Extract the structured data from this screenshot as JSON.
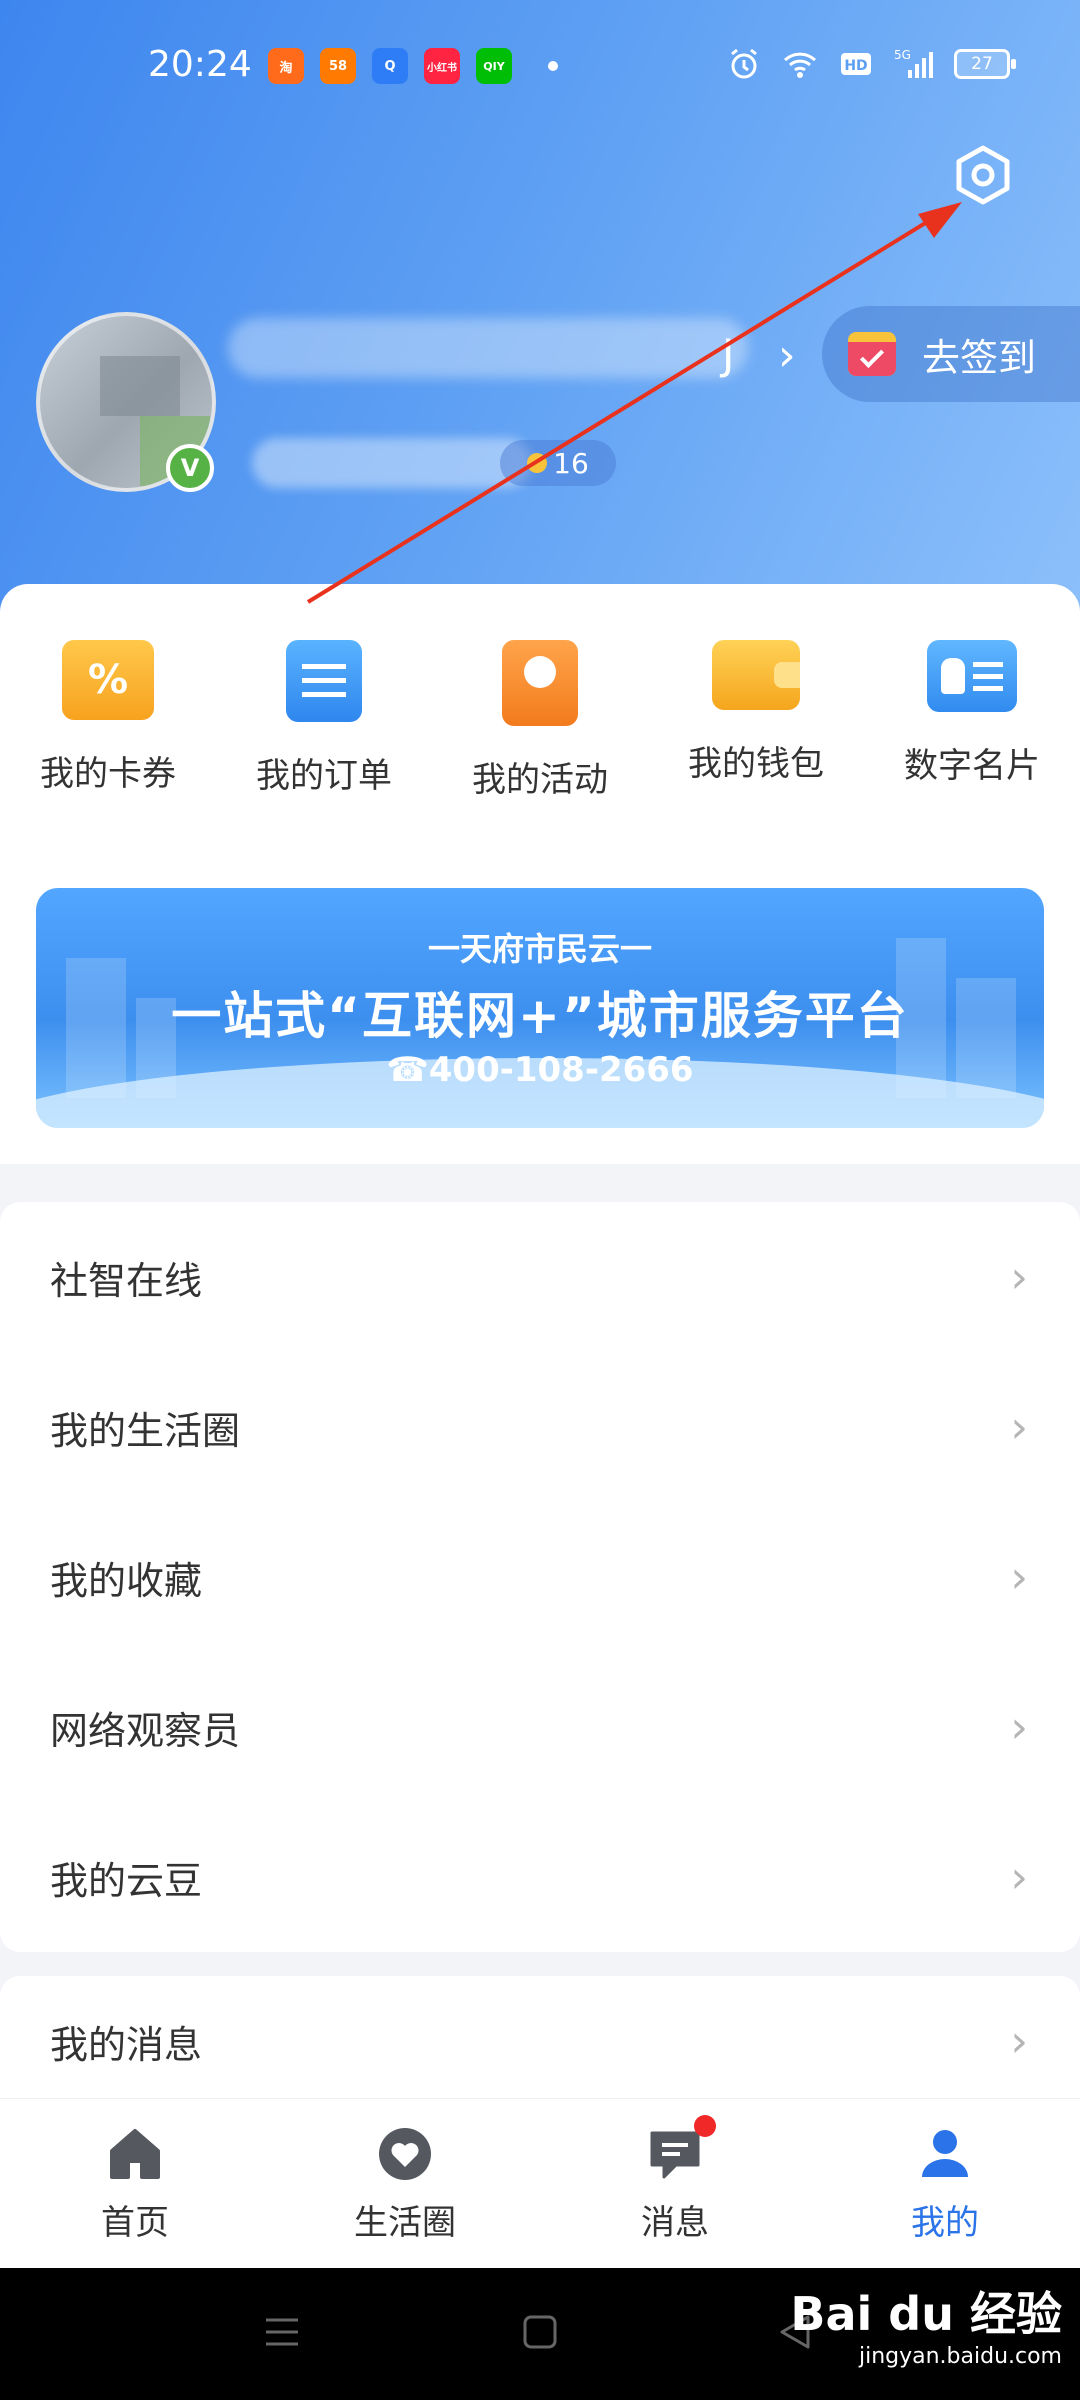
{
  "status_bar": {
    "time": "20:24",
    "apps": [
      {
        "name": "taobao-app-icon",
        "text": "淘",
        "color": "#ff6a1b"
      },
      {
        "name": "58-app-icon",
        "text": "58",
        "color": "#ff7a00"
      },
      {
        "name": "browser-app-icon",
        "text": "Q",
        "color": "#2f7df6"
      },
      {
        "name": "xiaohongshu-app-icon",
        "text": "小红书",
        "color": "#ff2442"
      },
      {
        "name": "iqiyi-app-icon",
        "text": "QIY",
        "color": "#00be06"
      }
    ],
    "battery": "27",
    "network": "5G"
  },
  "profile": {
    "name_visible_tail": "J",
    "level_value": "16"
  },
  "signin_label": "去签到",
  "quick_actions": [
    {
      "label": "我的卡券",
      "icon": "coupon-icon",
      "color": "#f7a21f"
    },
    {
      "label": "我的订单",
      "icon": "order-icon",
      "color": "#2f86ee"
    },
    {
      "label": "我的活动",
      "icon": "activity-icon",
      "color": "#f27b1c"
    },
    {
      "label": "我的钱包",
      "icon": "wallet-icon",
      "color": "#f5a51d"
    },
    {
      "label": "数字名片",
      "icon": "business-card-icon",
      "color": "#318bef"
    }
  ],
  "banner": {
    "line1": "一天府市民云一",
    "line2": "一站式“互联网+”城市服务平台",
    "line3": "☎400-108-2666"
  },
  "menu": [
    {
      "label": "社智在线"
    },
    {
      "label": "我的生活圈"
    },
    {
      "label": "我的收藏"
    },
    {
      "label": "网络观察员"
    },
    {
      "label": "我的云豆"
    }
  ],
  "menu_secondary": [
    {
      "label": "我的消息"
    }
  ],
  "tabs": [
    {
      "label": "首页",
      "icon": "home-icon"
    },
    {
      "label": "生活圈",
      "icon": "heart-circle-icon"
    },
    {
      "label": "消息",
      "icon": "message-icon",
      "badge": true
    },
    {
      "label": "我的",
      "icon": "person-icon",
      "active": true
    }
  ],
  "watermark": {
    "brand": "Bai du 经验",
    "url": "jingyan.baidu.com"
  },
  "colors": {
    "accent": "#2a73e8",
    "header_start": "#3e86ef",
    "header_end": "#8cc0fb",
    "annotation_arrow": "#e8321e"
  }
}
